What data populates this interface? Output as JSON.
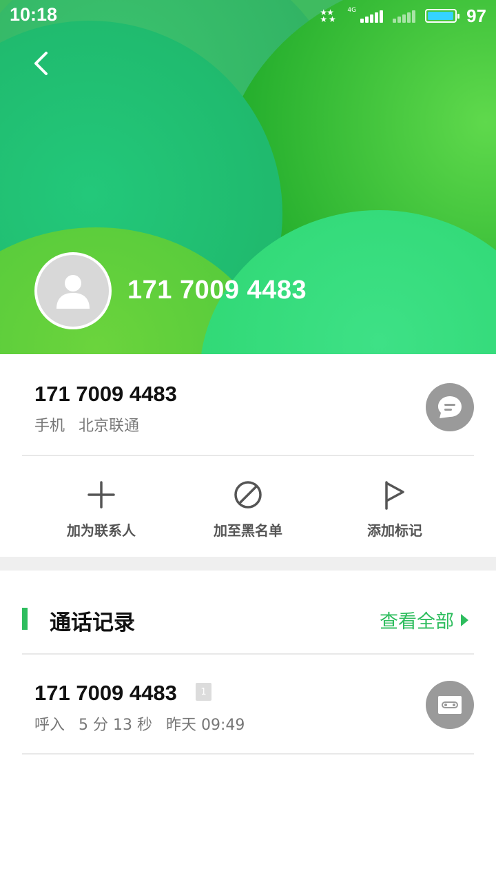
{
  "status_bar": {
    "time": "10:18",
    "network": "4G",
    "battery": "97",
    "battery_level_percent": 97
  },
  "header": {
    "phone_number": "171 7009 4483",
    "back_icon": "chevron-left-icon",
    "avatar_icon": "person-icon"
  },
  "number_card": {
    "phone_number": "171 7009 4483",
    "type": "手机",
    "carrier": "北京联通",
    "message_icon": "message-bubble-icon"
  },
  "actions": [
    {
      "label": "加为联系人",
      "icon": "plus-icon"
    },
    {
      "label": "加至黑名单",
      "icon": "block-icon"
    },
    {
      "label": "添加标记",
      "icon": "flag-icon"
    }
  ],
  "call_log": {
    "title": "通话记录",
    "view_all": "查看全部",
    "entries": [
      {
        "number": "171 7009 4483",
        "sim": "1",
        "direction": "呼入",
        "duration": "5 分 13 秒",
        "time": "昨天 09:49",
        "recording_icon": "cassette-icon"
      }
    ]
  },
  "colors": {
    "accent": "#2ebd5e",
    "icon_button": "#9a9a9a"
  }
}
